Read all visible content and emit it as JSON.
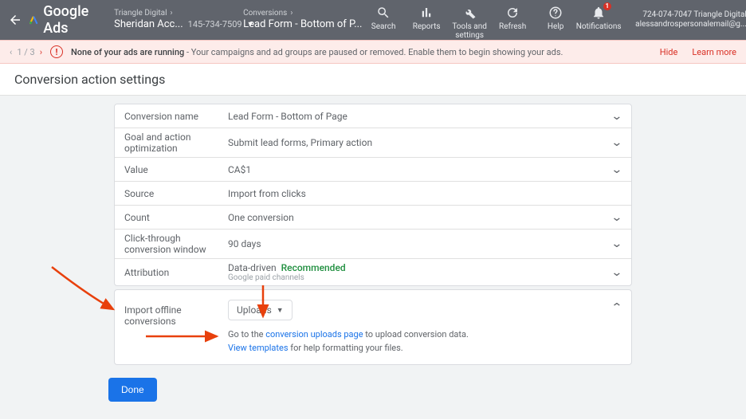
{
  "header": {
    "product": "Google Ads",
    "bc1_top": "Triangle Digital",
    "bc1_main": "Sheridan Acc...",
    "bc1_sub": "145-734-7509",
    "bc2_top": "Conversions",
    "bc2_main": "Lead Form - Bottom of P...",
    "tools": {
      "search": "Search",
      "reports": "Reports",
      "tools": "Tools and settings",
      "refresh": "Refresh",
      "help": "Help",
      "notifications": "Notifications",
      "notif_badge": "1"
    },
    "account_phone": "724-074-7047 Triangle Digital",
    "account_email": "alessandrospersonalemail@g..."
  },
  "warnbar": {
    "pos": "1 / 3",
    "bold": "None of your ads are running",
    "rest": " - Your campaigns and ad groups are paused or removed. Enable them to begin showing your ads.",
    "hide": "Hide",
    "learn": "Learn more"
  },
  "page_title": "Conversion action settings",
  "rows": [
    {
      "label": "Conversion name",
      "value": "Lead Form - Bottom of Page",
      "sub": ""
    },
    {
      "label": "Goal and action optimization",
      "value": "Submit lead forms, Primary action",
      "sub": ""
    },
    {
      "label": "Value",
      "value": "CA$1",
      "sub": ""
    },
    {
      "label": "Source",
      "value": "Import from clicks",
      "sub": "",
      "nochev": true
    },
    {
      "label": "Count",
      "value": "One conversion",
      "sub": ""
    },
    {
      "label": "Click-through conversion window",
      "value": "90 days",
      "sub": ""
    },
    {
      "label": "Attribution",
      "value": "Data-driven",
      "sub": "Google paid channels",
      "recommended": "Recommended"
    }
  ],
  "import": {
    "label": "Import offline conversions",
    "uploads": "Uploads",
    "help1a": "Go to the ",
    "help1link": "conversion uploads page",
    "help1b": " to upload conversion data.",
    "help2link": "View templates",
    "help2b": " for help formatting your files."
  },
  "done": "Done"
}
